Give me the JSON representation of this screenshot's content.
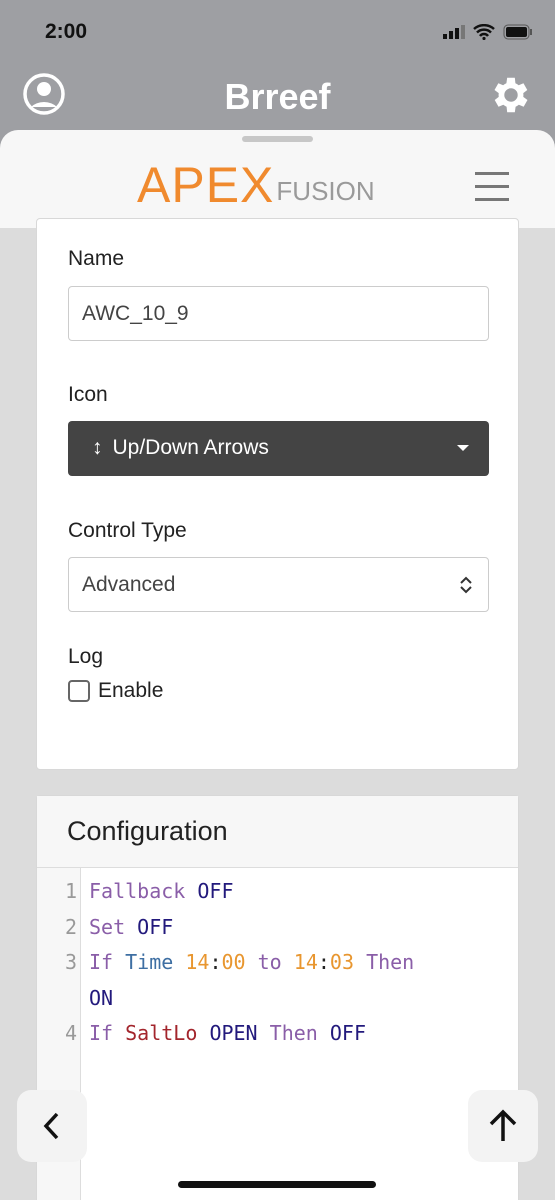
{
  "status": {
    "time": "2:00"
  },
  "app": {
    "title": "Brreef"
  },
  "logo": {
    "apex": "APEX",
    "fusion": "FUSION",
    "color": "#f08a2e"
  },
  "form": {
    "name_label": "Name",
    "name_value": "AWC_10_9",
    "icon_label": "Icon",
    "icon_value": "Up/Down Arrows",
    "icon_glyph": "up-down-arrows",
    "control_label": "Control Type",
    "control_value": "Advanced",
    "log_label": "Log",
    "enable_label": "Enable",
    "enable_checked": false
  },
  "config": {
    "title": "Configuration",
    "lines": [
      {
        "num": "1",
        "tokens": [
          {
            "t": "Fallback",
            "c": "kw"
          },
          {
            "t": " "
          },
          {
            "t": "OFF",
            "c": "val"
          }
        ]
      },
      {
        "num": "2",
        "tokens": [
          {
            "t": "Set",
            "c": "kw"
          },
          {
            "t": " "
          },
          {
            "t": "OFF",
            "c": "val"
          }
        ]
      },
      {
        "num": "3",
        "tokens": [
          {
            "t": "If",
            "c": "kw"
          },
          {
            "t": " "
          },
          {
            "t": "Time",
            "c": "fn"
          },
          {
            "t": " "
          },
          {
            "t": "14",
            "c": "num"
          },
          {
            "t": ":",
            "c": "pun"
          },
          {
            "t": "00",
            "c": "num"
          },
          {
            "t": " "
          },
          {
            "t": "to",
            "c": "kw"
          },
          {
            "t": " "
          },
          {
            "t": "14",
            "c": "num"
          },
          {
            "t": ":",
            "c": "pun"
          },
          {
            "t": "03",
            "c": "num"
          },
          {
            "t": " "
          },
          {
            "t": "Then",
            "c": "kw"
          }
        ]
      },
      {
        "num": "",
        "tokens": [
          {
            "t": "ON",
            "c": "val"
          }
        ]
      },
      {
        "num": "4",
        "tokens": [
          {
            "t": "If",
            "c": "kw"
          },
          {
            "t": " "
          },
          {
            "t": "SaltLo",
            "c": "dev"
          },
          {
            "t": " "
          },
          {
            "t": "OPEN",
            "c": "val"
          },
          {
            "t": " "
          },
          {
            "t": "Then",
            "c": "kw"
          },
          {
            "t": " "
          },
          {
            "t": "OFF",
            "c": "val"
          }
        ]
      }
    ]
  }
}
